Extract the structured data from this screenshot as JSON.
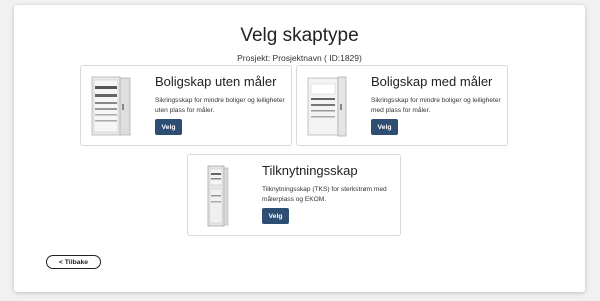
{
  "page": {
    "title": "Velg skaptype",
    "project_label": "Prosjekt: Prosjektnavn ( ID:1829)"
  },
  "cards": [
    {
      "title": "Boligskap uten måler",
      "description": "Sikringsskap for mindre boliger og leiligheter uten plass for måler.",
      "button_label": "Velg",
      "image_icon": "cabinet-open-icon"
    },
    {
      "title": "Boligskap med måler",
      "description": "Sikringsskap for mindre boliger og leiligheter med plass for måler.",
      "button_label": "Velg",
      "image_icon": "cabinet-meter-icon"
    },
    {
      "title": "Tilknytningsskap",
      "description": "Tilknytningsskap (TKS) for sterkstrøm med målerplass og EKOM.",
      "button_label": "Velg",
      "image_icon": "tall-cabinet-icon"
    }
  ],
  "back_button": {
    "label": "< Tilbake"
  },
  "colors": {
    "accent": "#2d4d72",
    "background": "#f1f1f1",
    "card_border": "#d9d9d9"
  }
}
